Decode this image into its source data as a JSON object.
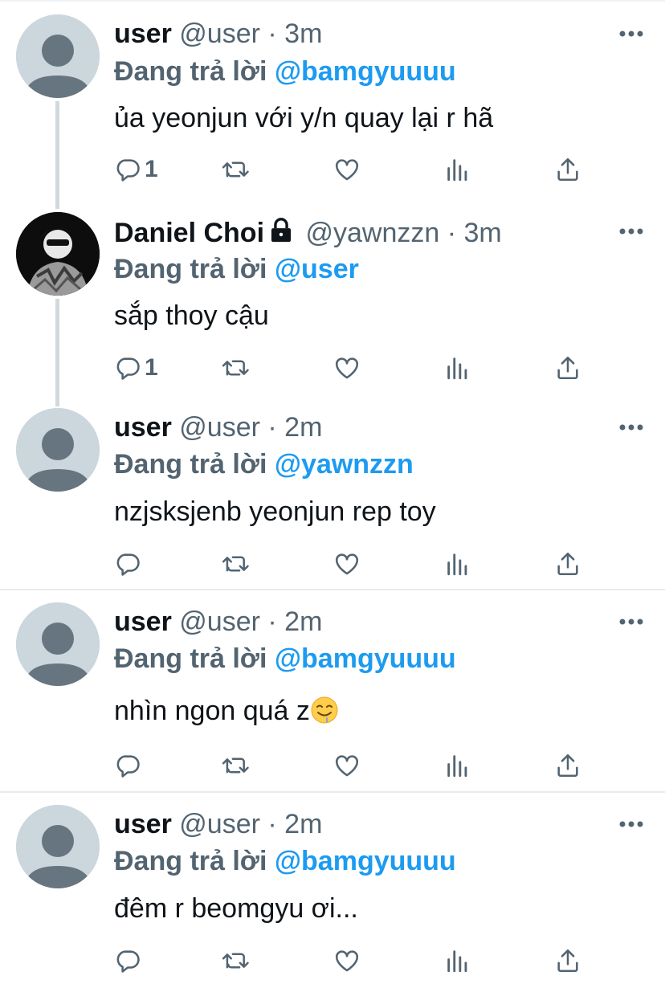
{
  "colors": {
    "accent": "#1d9bf0",
    "muted": "#536471",
    "text": "#0f1419",
    "avatar_default": "#ccd6dd"
  },
  "icons": [
    "more-icon",
    "reply-icon",
    "retweet-icon",
    "like-icon",
    "views-icon",
    "share-icon",
    "lock-icon"
  ],
  "tweets": [
    {
      "name": "user",
      "handle": "@user",
      "sep": "·",
      "time": "3m",
      "replying_prefix": "Đang trả lời",
      "replying_to": "@bamgyuuuu",
      "text": "ủa yeonjun với y/n quay lại r hã",
      "reply_count": "1"
    },
    {
      "name": "Daniel Choi",
      "handle": "@yawnzzn",
      "sep": "·",
      "time": "3m",
      "replying_prefix": "Đang trả lời",
      "replying_to": "@user",
      "text": "sắp thoy cậu",
      "reply_count": "1"
    },
    {
      "name": "user",
      "handle": "@user",
      "sep": "·",
      "time": "2m",
      "replying_prefix": "Đang trả lời",
      "replying_to": "@yawnzzn",
      "text": "nzjsksjenb yeonjun rep toy",
      "reply_count": ""
    },
    {
      "name": "user",
      "handle": "@user",
      "sep": "·",
      "time": "2m",
      "replying_prefix": "Đang trả lời",
      "replying_to": "@bamgyuuuu",
      "text": "nhìn ngon quá z",
      "emoji": "drooling-face",
      "reply_count": ""
    },
    {
      "name": "user",
      "handle": "@user",
      "sep": "·",
      "time": "2m",
      "replying_prefix": "Đang trả lời",
      "replying_to": "@bamgyuuuu",
      "text": "đêm r beomgyu ơi...",
      "reply_count": ""
    }
  ]
}
